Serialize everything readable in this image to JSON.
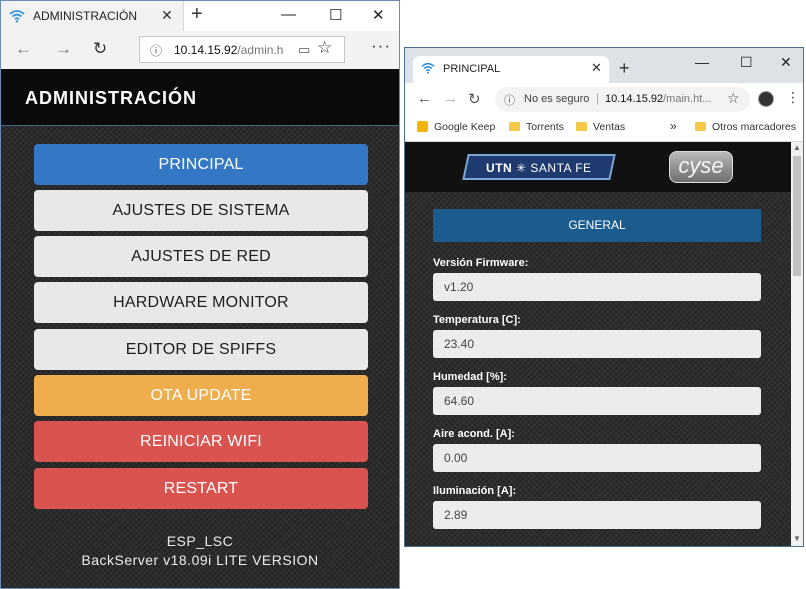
{
  "edge": {
    "tab_title": "ADMINISTRACIÓN",
    "tab_close": "✕",
    "new_tab": "+",
    "win_min": "—",
    "win_max": "☐",
    "win_close": "✕",
    "back": "←",
    "forward": "→",
    "refresh": "↻",
    "url_host": "10.14.15.92",
    "url_path": "/admin.h",
    "star": "☆",
    "more": "···",
    "header_title": "ADMINISTRACIÓN",
    "buttons": [
      "PRINCIPAL",
      "AJUSTES DE SISTEMA",
      "AJUSTES DE RED",
      "HARDWARE MONITOR",
      "EDITOR DE SPIFFS",
      "OTA UPDATE",
      "REINICIAR WIFI",
      "RESTART"
    ],
    "footer_line1": "ESP_LSC",
    "footer_line2": "BackServer v18.09i LITE VERSION"
  },
  "chrome": {
    "tab_title": "PRINCIPAL",
    "tab_close": "✕",
    "new_tab": "+",
    "win_min": "—",
    "win_max": "☐",
    "win_close": "✕",
    "back": "←",
    "forward": "→",
    "refresh": "↻",
    "not_secure": "No es seguro",
    "url_host": "10.14.15.92",
    "url_path": "/main.ht...",
    "star": "☆",
    "menu": "⋮",
    "bookmarks": [
      "Google Keep",
      "Torrents",
      "Ventas"
    ],
    "bookmarks_overflow": "»",
    "other_bookmarks": "Otros marcadores",
    "logo_utn_bold": "UTN",
    "logo_utn_rest": "SANTA FE",
    "logo_cyse": "cyse",
    "section_button": "GENERAL",
    "fields": [
      {
        "label": "Versión Firmware:",
        "value": "v1.20"
      },
      {
        "label": "Temperatura [C]:",
        "value": "23.40"
      },
      {
        "label": "Humedad [%]:",
        "value": "64.60"
      },
      {
        "label": "Aire acond. [A]:",
        "value": "0.00"
      },
      {
        "label": "Iluminación [A]:",
        "value": "2.89"
      }
    ]
  },
  "colors": {
    "principal": "#3377c5",
    "menu_gray": "#e8e8e8",
    "ota": "#f0ad4e",
    "danger": "#d9534f",
    "general": "#1b5c8e"
  }
}
